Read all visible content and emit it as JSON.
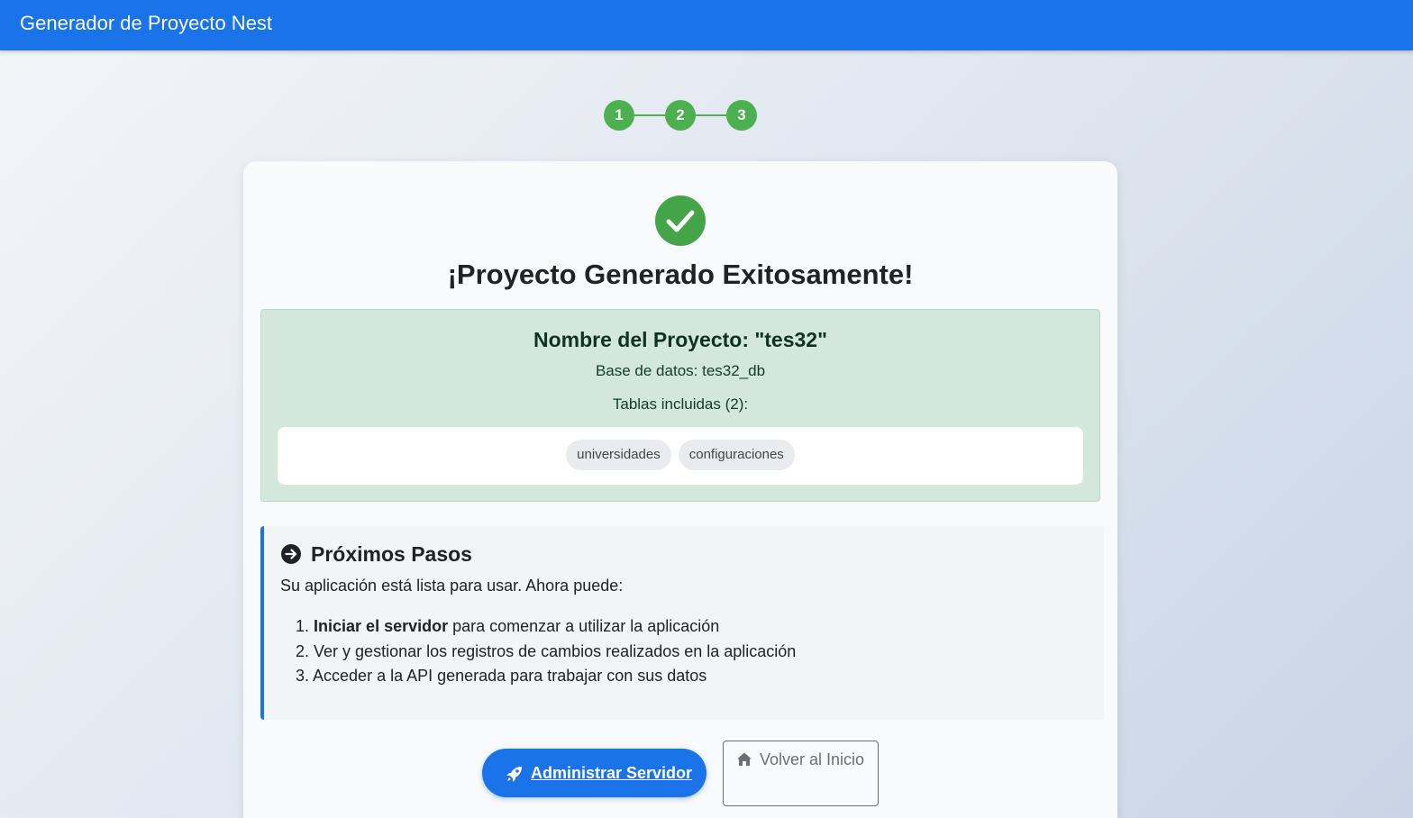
{
  "header": {
    "title": "Generador de Proyecto Nest",
    "accent_color": "#1a73e8"
  },
  "stepper": {
    "steps": [
      "1",
      "2",
      "3"
    ],
    "completed_color": "#4caf50"
  },
  "success": {
    "icon": "check-circle-icon",
    "title": "¡Proyecto Generado Exitosamente!"
  },
  "project": {
    "name_text": "Nombre del Proyecto: \"tes32\"",
    "database_text": "Base de datos: tes32_db",
    "tables_text": "Tablas incluidas (2):",
    "tables": [
      "universidades",
      "configuraciones"
    ]
  },
  "next_steps": {
    "icon": "arrow-right-circle-icon",
    "title": "Próximos Pasos",
    "intro": "Su aplicación está lista para usar. Ahora puede:",
    "items": [
      {
        "number": "1.",
        "bold": "Iniciar el servidor",
        "rest": " para comenzar a utilizar la aplicación"
      },
      {
        "number": "2.",
        "bold": "",
        "rest": "Ver y gestionar los registros de cambios realizados en la aplicación"
      },
      {
        "number": "3.",
        "bold": "",
        "rest": "Acceder a la API generada para trabajar con sus datos"
      }
    ]
  },
  "actions": {
    "admin_label": "Administrar Servidor",
    "admin_icon": "rocket-icon",
    "home_label": "Volver al Inicio",
    "home_icon": "home-icon"
  }
}
